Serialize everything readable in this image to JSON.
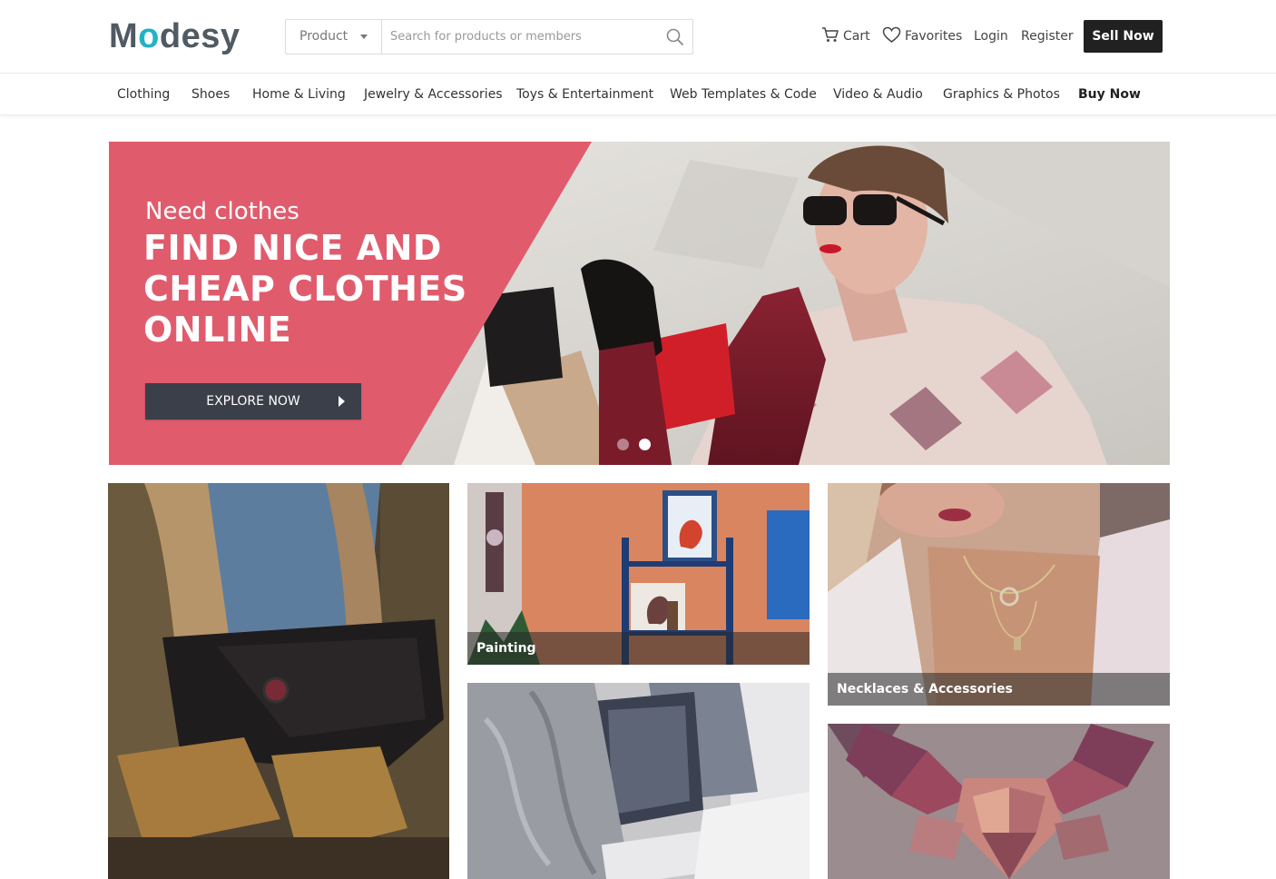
{
  "logo": {
    "part1": "M",
    "accent": "o",
    "part2": "desy"
  },
  "search": {
    "category": "Product",
    "placeholder": "Search for products or members"
  },
  "header": {
    "cart": "Cart",
    "favorites": "Favorites",
    "login": "Login",
    "register": "Register",
    "sell_now": "Sell Now"
  },
  "categories": [
    {
      "label": "Clothing"
    },
    {
      "label": "Shoes"
    },
    {
      "label": "Home & Living"
    },
    {
      "label": "Jewelry & Accessories"
    },
    {
      "label": "Toys & Entertainment"
    },
    {
      "label": "Web Templates & Code"
    },
    {
      "label": "Video & Audio"
    },
    {
      "label": "Graphics & Photos"
    },
    {
      "label": "Buy Now"
    }
  ],
  "hero": {
    "subtitle": "Need clothes",
    "title": "FIND NICE AND CHEAP CLOTHES ONLINE",
    "cta": "EXPLORE NOW",
    "slides_total": 2,
    "active_slide": 2,
    "accent_color": "#e05c6d"
  },
  "tiles": [
    {
      "label": ""
    },
    {
      "label": "Painting"
    },
    {
      "label": "Necklaces & Accessories"
    },
    {
      "label": ""
    },
    {
      "label": ""
    }
  ],
  "colors": {
    "brand_accent": "#21b3c4",
    "logo_text": "#505a63",
    "sell_button": "#212121"
  }
}
